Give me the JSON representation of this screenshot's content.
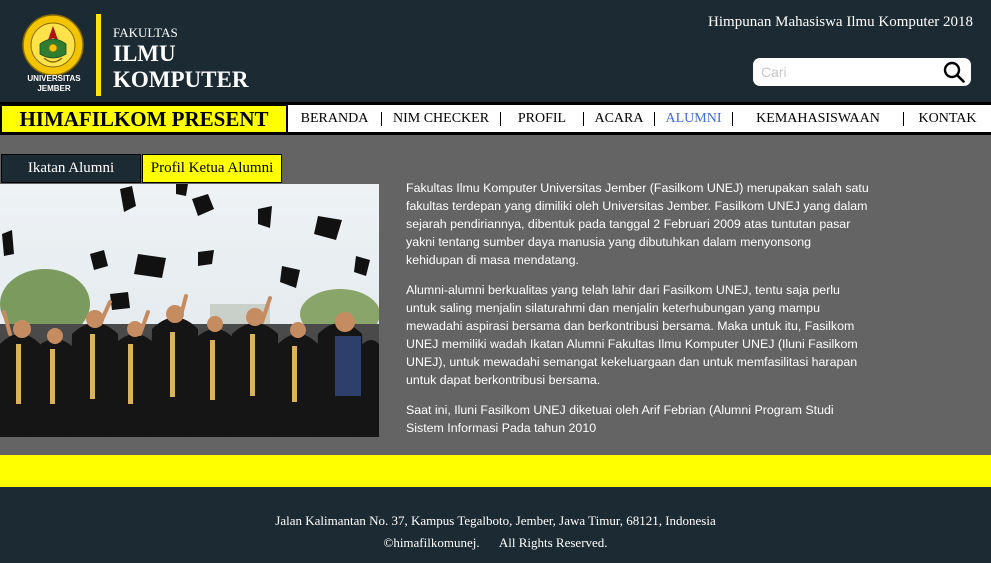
{
  "header": {
    "logo_caption_line1": "UNIVERSITAS",
    "logo_caption_line2": "JEMBER",
    "faculty_small": "FAKULTAS",
    "faculty_line1": "ILMU",
    "faculty_line2": "KOMPUTER",
    "org_title": "Himpunan Mahasiswa Ilmu Komputer 2018",
    "search_placeholder": "Cari"
  },
  "navbar": {
    "brand": "HIMAFILKOM PRESENT",
    "items": [
      {
        "label": "BERANDA"
      },
      {
        "label": "NIM CHECKER"
      },
      {
        "label": "PROFIL"
      },
      {
        "label": "ACARA"
      },
      {
        "label": "ALUMNI"
      },
      {
        "label": "KEMAHASISWAAN"
      },
      {
        "label": "KONTAK"
      }
    ],
    "active": "ALUMNI"
  },
  "main": {
    "tabs": [
      {
        "label": "Ikatan Alumni"
      },
      {
        "label": "Profil Ketua Alumni"
      }
    ],
    "paragraphs": [
      "Fakultas Ilmu Komputer Universitas Jember (Fasilkom UNEJ) merupakan salah satu fakultas terdepan yang dimiliki oleh Universitas Jember. Fasilkom UNEJ yang dalam sejarah pendiriannya, dibentuk pada tanggal 2 Februari 2009 atas tuntutan pasar yakni tentang sumber daya manusia yang dibutuhkan dalam menyonsong kehidupan di masa mendatang.",
      "Alumni-alumni berkualitas yang telah lahir dari Fasilkom UNEJ, tentu saja perlu untuk saling menjalin silaturahmi dan menjalin keterhubungan yang mampu mewadahi aspirasi bersama dan berkontribusi bersama. Maka untuk itu, Fasilkom UNEJ memiliki wadah Ikatan Alumni Fakultas Ilmu Komputer UNEJ (Iluni Fasilkom UNEJ), untuk mewadahi semangat kekeluargaan dan untuk memfasilitasi harapan untuk dapat berkontribusi bersama.",
      "Saat ini, Iluni Fasilkom UNEJ diketuai oleh Arif Febrian (Alumni Program Studi Sistem Informasi Pada tahun 2010"
    ]
  },
  "footer": {
    "address": "Jalan Kalimantan No. 37, Kampus Tegalboto, Jember, Jawa Timur, 68121, Indonesia",
    "handle": "©himafilkomunej.",
    "rights": "All Rights Reserved."
  },
  "colors": {
    "dark": "#1b2a33",
    "yellow": "#ffff00",
    "gray": "#646464",
    "active_link": "#3f6bd6"
  }
}
